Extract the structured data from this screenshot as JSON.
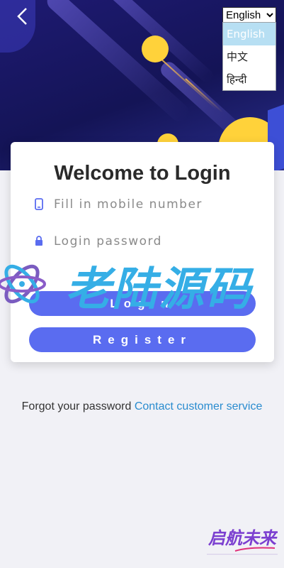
{
  "header": {
    "back_icon": "chevron-left-icon"
  },
  "language": {
    "selected": "English",
    "options": [
      "English",
      "中文",
      "हिन्दी"
    ]
  },
  "login": {
    "title": "Welcome to Login",
    "mobile_placeholder": "Fill in mobile number",
    "mobile_icon": "mobile-phone-icon",
    "password_placeholder": "Login password",
    "password_icon": "lock-icon",
    "login_button": "Login",
    "register_button": "Register"
  },
  "footer": {
    "forgot_text": "Forgot your password",
    "contact_link": "Contact customer service"
  },
  "watermark": {
    "text": "老陆源码"
  },
  "stamp": {
    "text": "启航未来"
  },
  "colors": {
    "accent": "#5a6cf0",
    "link": "#2a8ccf",
    "hero_dark": "#141456",
    "ball_yellow": "#ffd23a",
    "watermark_blue": "#35aee6"
  }
}
